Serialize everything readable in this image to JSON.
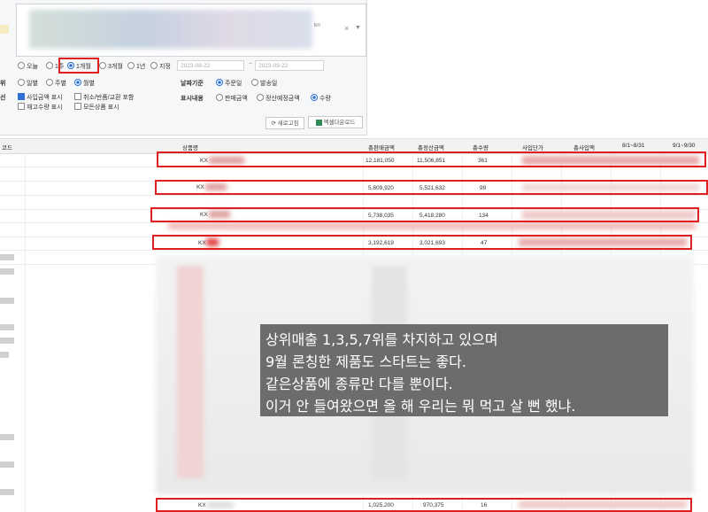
{
  "filters": {
    "period_options": [
      "오늘",
      "1주",
      "1개월",
      "3개월",
      "1년",
      "지정"
    ],
    "period_selected": "1개월",
    "date_from": "2022-08-22",
    "date_sep": "~",
    "date_to": "2022-09-22",
    "unit_label": "위",
    "unit_options": [
      "일별",
      "주별",
      "월별"
    ],
    "unit_selected": "월별",
    "date_basis_label": "날짜기준",
    "date_basis_options": [
      "주문일",
      "발송일"
    ],
    "date_basis_selected": "주문일",
    "select_label": "선",
    "check_purchase": "사입금액 표시",
    "check_cancel": "취소/반품/교환 포함",
    "check_stock": "재고수량 표시",
    "check_all_products": "모든상품 표시",
    "display_label": "표시내용",
    "display_options": [
      "판매금액",
      "정산예정금액",
      "수량"
    ],
    "display_selected": "수량",
    "refresh_label": "새로고침",
    "excel_label": "엑셀다운로드",
    "select_box_suffix": "kn"
  },
  "table": {
    "headers": {
      "code": "코드",
      "product": "상품명",
      "total_sales": "총판매금액",
      "total_settle": "총정산금액",
      "total_qty": "총수량",
      "purchase_price": "사입단가",
      "total_purchase": "총사입액",
      "month1": "8/1~8/31",
      "month2": "9/1~9/30"
    },
    "rows": [
      {
        "product": "KX",
        "sales": "12,181,050",
        "settle": "11,506,851",
        "qty": "361"
      },
      {
        "product": "KX",
        "sales": "5,809,920",
        "settle": "5,521,632",
        "qty": "99"
      },
      {
        "product": "KX",
        "sales": "5,738,035",
        "settle": "5,418,280",
        "qty": "134"
      },
      {
        "product": "KX",
        "sales": "3,192,619",
        "settle": "3,021,693",
        "qty": "47"
      },
      {
        "product": "KX",
        "sales": "1,025,200",
        "settle": "970,375",
        "qty": "16"
      }
    ]
  },
  "caption": {
    "line1": "상위매출 1,3,5,7위를 차지하고 있으며",
    "line2": "9월 론칭한 제품도 스타트는 좋다.",
    "line3": "같은상품에 종류만 다를 뿐이다.",
    "line4": "이거 안 들여왔으면 올 해 우리는 뭐 먹고 살 뻔 했냐."
  },
  "colors": {
    "highlight": "#e02020",
    "accent": "#2f6fd6",
    "caption_bg": "#6c6c6c"
  }
}
